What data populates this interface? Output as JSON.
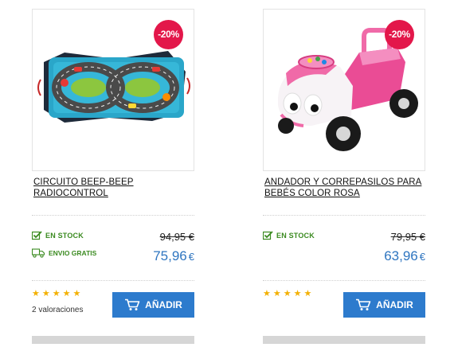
{
  "products": [
    {
      "discount_badge": "-20%",
      "title_line1": "CIRCUITO BEEP-BEEP",
      "title_line2": "RADIOCONTROL",
      "stock_label": "EN STOCK",
      "shipping_label": "ENVIO GRATIS",
      "old_price": "94,95 €",
      "new_price": "75,96",
      "currency": "€",
      "rating": 5,
      "reviews": "2 valoraciones",
      "add_button_label": "AÑADIR",
      "image_icon": "race-track-playmat-image"
    },
    {
      "discount_badge": "-20%",
      "title_line1": "ANDADOR Y CORREPASILOS PARA",
      "title_line2": "BEBÉS COLOR ROSA",
      "stock_label": "EN STOCK",
      "old_price": "79,95 €",
      "new_price": "63,96",
      "currency": "€",
      "rating": 5,
      "add_button_label": "AÑADIR",
      "image_icon": "pink-ride-on-car-image"
    }
  ],
  "colors": {
    "badge": "#e3174a",
    "button": "#2d7bcd",
    "price": "#2e75c0",
    "stock": "#3a8a1f",
    "star": "#f3b000"
  }
}
